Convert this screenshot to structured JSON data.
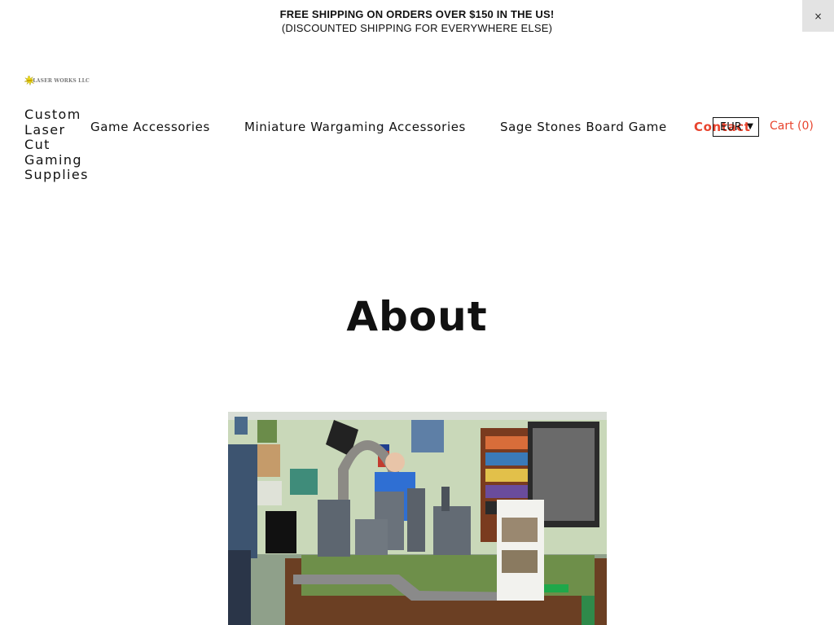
{
  "announcement": {
    "line1": "FREE SHIPPING ON ORDERS OVER $150 IN THE US!",
    "line2": "(DISCOUNTED SHIPPING FOR EVERYWHERE ELSE)",
    "close_label": "×"
  },
  "header": {
    "logo_text": "LASER WORKS LLC",
    "nav": [
      {
        "label": "Custom Laser Cut Gaming Supplies"
      },
      {
        "label": "Game Accessories"
      },
      {
        "label": "Miniature Wargaming Accessories"
      },
      {
        "label": "Sage Stones Board Game"
      },
      {
        "label": "Contact"
      }
    ],
    "currency": "EUR",
    "cart_label": "Cart (0)"
  },
  "main": {
    "title": "About"
  },
  "colors": {
    "accent": "#e8442e",
    "text": "#111111",
    "close_bg": "#e3e3e3"
  },
  "icons": {
    "close": "close-icon",
    "caret": "caret-down-icon",
    "logo": "starburst-logo-icon"
  }
}
